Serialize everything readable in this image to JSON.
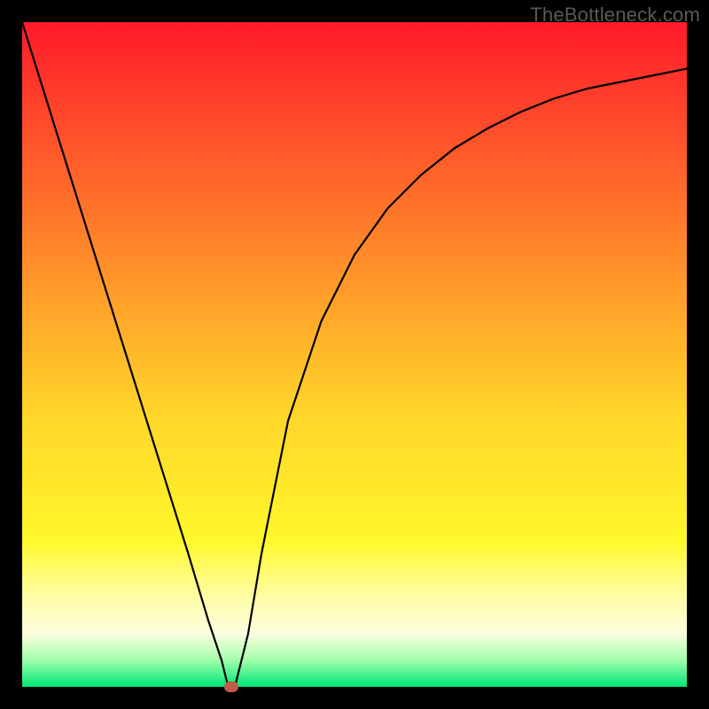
{
  "watermark": "TheBottleneck.com",
  "chart_data": {
    "type": "line",
    "title": "",
    "xlabel": "",
    "ylabel": "",
    "ylim": [
      0,
      100
    ],
    "xlim": [
      0,
      100
    ],
    "grid": false,
    "series": [
      {
        "name": "curve",
        "x": [
          0,
          5,
          10,
          15,
          20,
          25,
          28,
          30,
          31,
          32,
          34,
          36,
          40,
          45,
          50,
          55,
          60,
          65,
          70,
          75,
          80,
          85,
          90,
          95,
          100
        ],
        "values": [
          100,
          84,
          68,
          52,
          36,
          20,
          10,
          4,
          0,
          0,
          8,
          20,
          40,
          55,
          65,
          72,
          77,
          81,
          84,
          86.5,
          88.5,
          90,
          91,
          92,
          93
        ]
      }
    ],
    "marker": {
      "x": 31.5,
      "y": 0
    },
    "colors": {
      "background_gradient_top": "#ff1a2a",
      "background_gradient_bottom": "#00e676",
      "curve": "#000000",
      "marker": "#c25a4a",
      "frame": "#000000"
    }
  }
}
